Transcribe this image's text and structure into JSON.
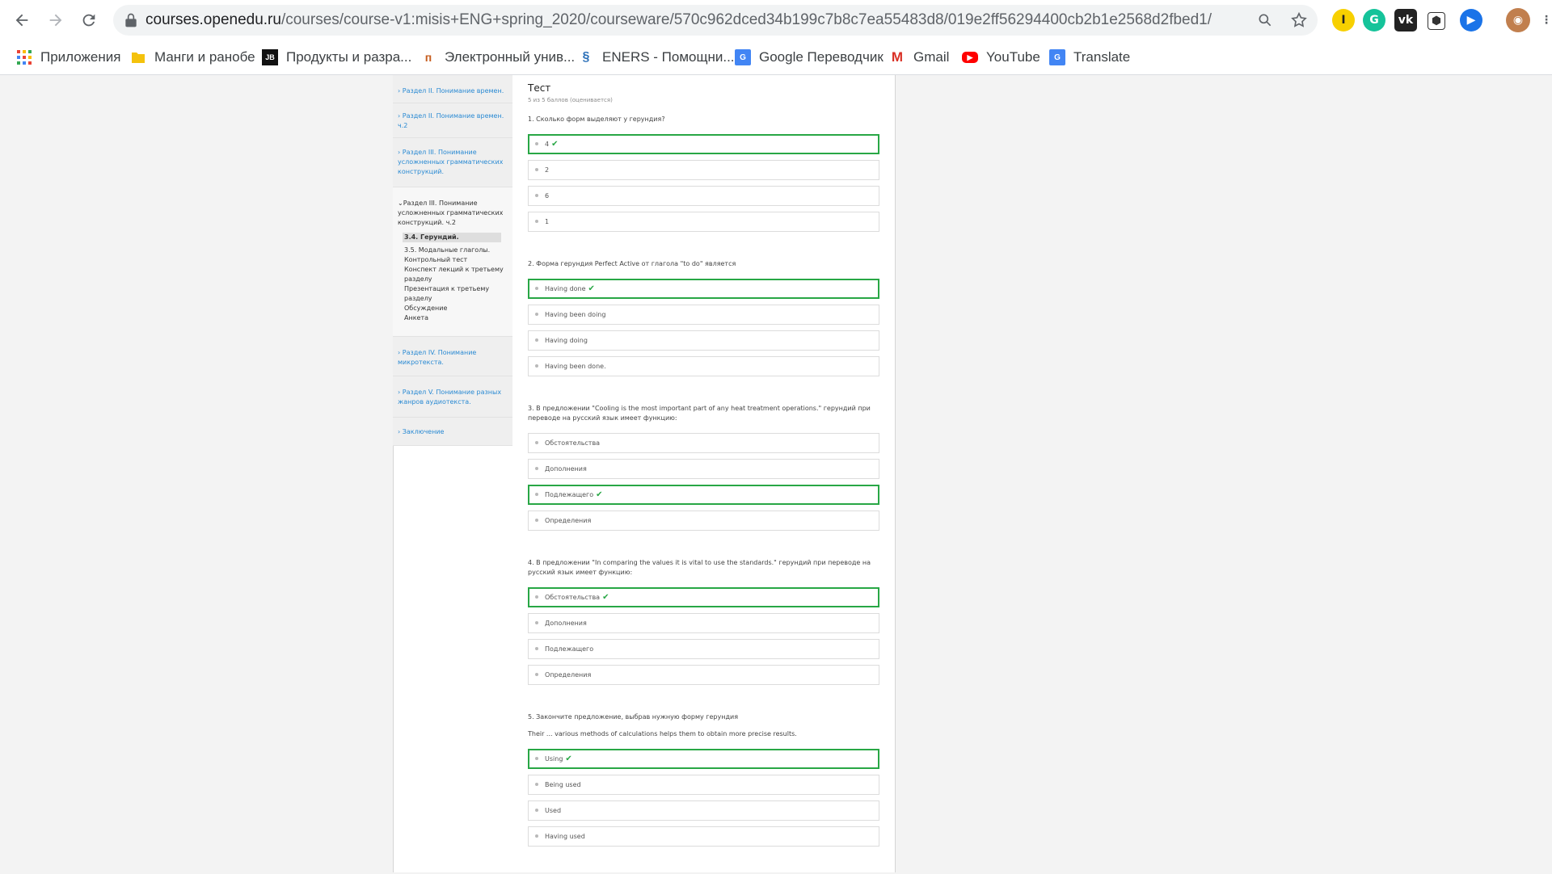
{
  "browser": {
    "url_host": "courses.openedu.ru",
    "url_path": "/courses/course-v1:misis+ENG+spring_2020/courseware/570c962dced34b199c7b8c7ea55483d8/019e2ff56294400cb2b1e2568d2fbed1/?child=last",
    "bookmarks": [
      {
        "label": "Приложения",
        "icon": "apps-grid-icon"
      },
      {
        "label": "Манги и ранобе",
        "icon": "folder-icon"
      },
      {
        "label": "Продукты и разра...",
        "icon": "jetbrains-icon"
      },
      {
        "label": "Электронный унив...",
        "icon": "university-icon"
      },
      {
        "label": "ENERS - Помощни...",
        "icon": "eners-icon"
      },
      {
        "label": "Google Переводчик",
        "icon": "google-translate-icon"
      },
      {
        "label": "Gmail",
        "icon": "gmail-icon"
      },
      {
        "label": "YouTube",
        "icon": "youtube-icon"
      },
      {
        "label": "Translate",
        "icon": "translate-icon"
      }
    ]
  },
  "sidebar": {
    "sections": [
      {
        "label": "› Раздел II. Понимание времен."
      },
      {
        "label": "› Раздел II. Понимание времен. ч.2"
      },
      {
        "label": "› Раздел III. Понимание усложненных грамматических конструкций."
      }
    ],
    "active_section": {
      "label": "⌄Раздел III. Понимание усложненных грамматических конструкций. ч.2",
      "items": [
        "3.4. Герундий.",
        "3.5. Модальные глаголы.",
        "Контрольный тест",
        "Конспект лекций к третьему разделу",
        "Презентация к третьему разделу",
        "Обсуждение",
        "Анкета"
      ]
    },
    "after_sections": [
      {
        "label": "› Раздел IV. Понимание микротекста."
      },
      {
        "label": "› Раздел V. Понимание разных жанров аудиотекста."
      },
      {
        "label": "› Заключение"
      }
    ]
  },
  "test": {
    "title": "Тест",
    "score": "5 из 5 баллов (оценивается)",
    "questions": [
      {
        "text": "1. Сколько форм выделяют у герундия?",
        "options": [
          "4",
          "2",
          "6",
          "1"
        ],
        "correct": 0
      },
      {
        "text": "2. Форма герундия Perfect Active от глагола \"to do\" является",
        "options": [
          "Having done",
          "Having been doing",
          "Having doing",
          "Having been done."
        ],
        "correct": 0
      },
      {
        "text": "3. В предложении \"Cooling is the most important part of any heat treatment operations.\" герундий при переводе на русский язык имеет функцию:",
        "options": [
          "Обстоятельства",
          "Дополнения",
          "Подлежащего",
          "Определения"
        ],
        "correct": 2
      },
      {
        "text": "4. В предложении \"In comparing the values it is vital to use the standards.\" герундий при переводе на русский язык имеет функцию:",
        "options": [
          "Обстоятельства",
          "Дополнения",
          "Подлежащего",
          "Определения"
        ],
        "correct": 0
      },
      {
        "text": "5. Закончите предложение, выбрав нужную форму герундия",
        "sentence": "Their ... various methods of calculations helps them to obtain more precise results.",
        "options": [
          "Using",
          "Being used",
          "Used",
          "Having used"
        ],
        "correct": 0
      }
    ]
  },
  "colors": {
    "correct_border": "#28a745",
    "link_blue": "#2a8ad3"
  }
}
